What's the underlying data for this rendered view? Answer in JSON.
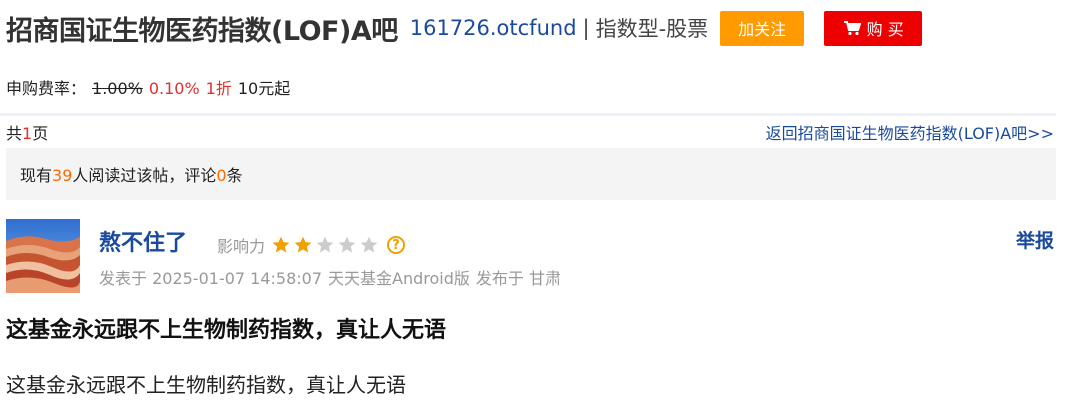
{
  "header": {
    "bar_title": "招商国证生物医药指数(LOF)A吧",
    "fund_code": "161726.otcfund",
    "separator": "|",
    "fund_type": "指数型-股票",
    "follow_label": "加关注",
    "buy_label": "购 买"
  },
  "fee": {
    "label": "申购费率：",
    "original_rate": "1.00%",
    "discount_rate": "0.10%",
    "discount": "1折",
    "minimum": "10元起"
  },
  "pager": {
    "prefix": "共",
    "pages": "1",
    "suffix": "页",
    "back_link": "返回招商国证生物医药指数(LOF)A吧>>"
  },
  "stats": {
    "prefix": "现有",
    "readers": "39",
    "middle": "人阅读过该帖，评论",
    "comments": "0",
    "suffix": "条"
  },
  "post": {
    "author": "熬不住了",
    "influence_label": "影响力",
    "influence_stars": 2,
    "influence_max": 5,
    "report_label": "举报",
    "posted_at": "发表于 2025-01-07 14:58:07",
    "client": "天天基金Android版",
    "location": "发布于 甘肃",
    "title": "这基金永远跟不上生物制药指数，真让人无语",
    "body": "这基金永远跟不上生物制药指数，真让人无语"
  },
  "colors": {
    "link_blue": "#1a4a9c",
    "follow_orange": "#ff9a00",
    "buy_red": "#ee0000",
    "star_gold": "#f0a000",
    "star_gray": "#cccccc"
  }
}
